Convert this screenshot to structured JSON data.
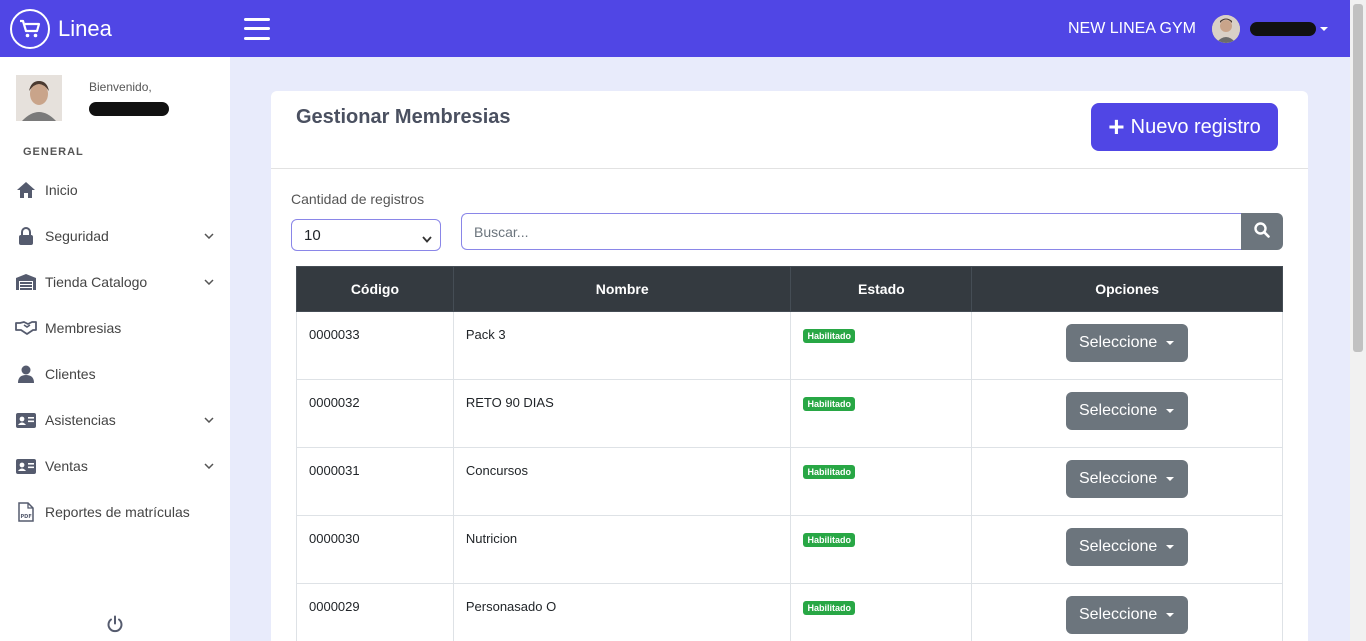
{
  "app": {
    "name": "Linea",
    "gym_name": "NEW LINEA GYM"
  },
  "sidebar": {
    "welcome": "Bienvenido,",
    "section": "GENERAL",
    "items": [
      {
        "label": "Inicio",
        "icon": "home-icon",
        "expandable": false
      },
      {
        "label": "Seguridad",
        "icon": "lock-icon",
        "expandable": true
      },
      {
        "label": "Tienda Catalogo",
        "icon": "warehouse-icon",
        "expandable": true
      },
      {
        "label": "Membresias",
        "icon": "handshake-icon",
        "expandable": false
      },
      {
        "label": "Clientes",
        "icon": "user-icon",
        "expandable": false
      },
      {
        "label": "Asistencias",
        "icon": "id-card-icon",
        "expandable": true
      },
      {
        "label": "Ventas",
        "icon": "id-card-icon",
        "expandable": true
      },
      {
        "label": "Reportes de matrículas",
        "icon": "pdf-file-icon",
        "expandable": false
      }
    ]
  },
  "main": {
    "title": "Gestionar Membresias",
    "new_button": "Nuevo registro",
    "count_label": "Cantidad de registros",
    "count_value": "10",
    "search_placeholder": "Buscar...",
    "columns": [
      "Código",
      "Nombre",
      "Estado",
      "Opciones"
    ],
    "rows": [
      {
        "code": "0000033",
        "name": "Pack 3",
        "status": "Habilitado",
        "action": "Seleccione"
      },
      {
        "code": "0000032",
        "name": "RETO 90 DIAS",
        "status": "Habilitado",
        "action": "Seleccione"
      },
      {
        "code": "0000031",
        "name": "Concursos",
        "status": "Habilitado",
        "action": "Seleccione"
      },
      {
        "code": "0000030",
        "name": "Nutricion",
        "status": "Habilitado",
        "action": "Seleccione"
      },
      {
        "code": "0000029",
        "name": "Personasado O",
        "status": "Habilitado",
        "action": "Seleccione"
      }
    ]
  },
  "colors": {
    "primary": "#5046e5",
    "success": "#28a745",
    "secondary": "#6c757d",
    "table_header": "#343a40"
  }
}
